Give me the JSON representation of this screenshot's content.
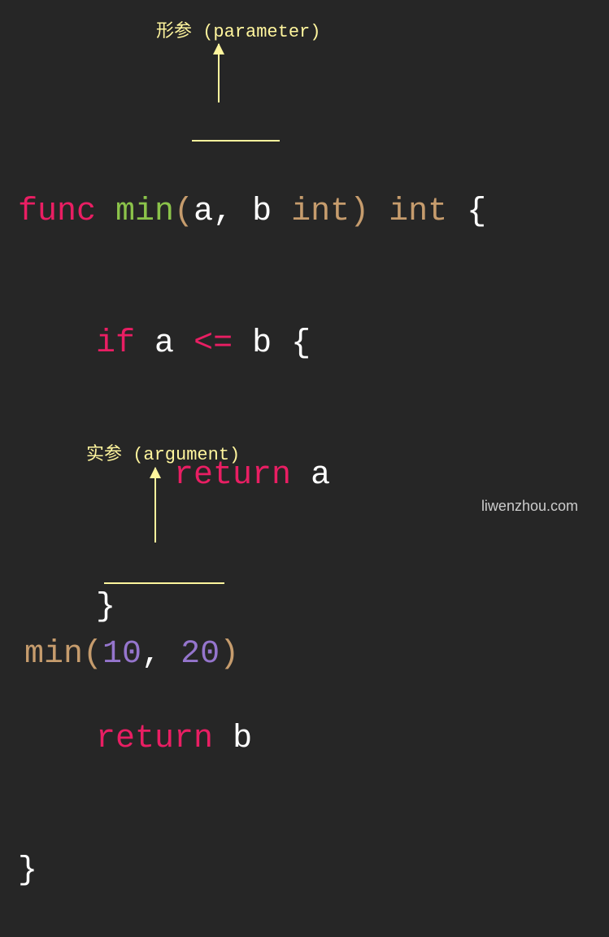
{
  "annotations": {
    "parameter": "形参 (parameter)",
    "argument": "实参 (argument)"
  },
  "code": {
    "func_keyword": "func",
    "function_name": "min",
    "param_list": "a, b",
    "param_type": "int",
    "return_type": "int",
    "if_keyword": "if",
    "condition_left": "a",
    "condition_op": "<=",
    "condition_right": "b",
    "return_keyword": "return",
    "return_a": "a",
    "return_b": "b",
    "call_name": "min",
    "arg1": "10",
    "arg2": "20"
  },
  "watermark": "liwenzhou.com",
  "colors": {
    "background": "#262626",
    "annotation": "#fff59d",
    "keyword": "#e91e63",
    "function": "#8bc34a",
    "type": "#c69c6d",
    "number": "#9575cd",
    "text": "#ffffff"
  }
}
